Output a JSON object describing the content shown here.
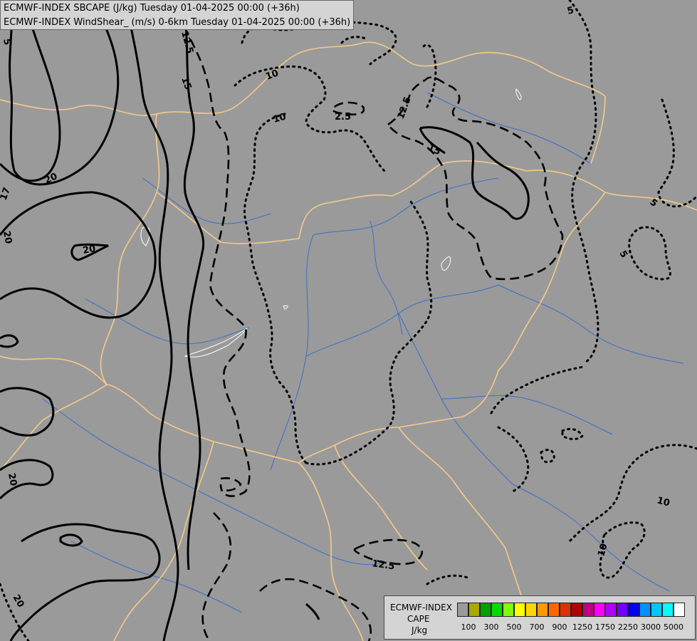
{
  "title": {
    "line1": "ECMWF-INDEX SBCAPE (J/kg) Tuesday 01-04-2025 00:00 (+36h)",
    "line2": "ECMWF-INDEX WindShear_ (m/s) 0-6km Tuesday 01-04-2025 00:00 (+36h)"
  },
  "legend": {
    "model": "ECMWF-INDEX",
    "variable": "CAPE",
    "unit": "J/kg",
    "colors": [
      "#9a9a9a",
      "#a8a800",
      "#00a000",
      "#00dc00",
      "#80ff00",
      "#ffff00",
      "#ffd700",
      "#ff9900",
      "#ff6600",
      "#e03000",
      "#b00000",
      "#c00080",
      "#ff00ff",
      "#b000ff",
      "#7000ff",
      "#0000ff",
      "#0090ff",
      "#00c8ff",
      "#00ffff",
      "#ffffff"
    ],
    "tick_labels": [
      "100",
      "300",
      "500",
      "700",
      "900",
      "1250",
      "1750",
      "2250",
      "3000",
      "5000"
    ]
  },
  "contour_labels": {
    "l15": "15",
    "l125": "12.5",
    "l10": "10",
    "l5": "5",
    "l20": "20",
    "l25": "2.5",
    "l17": "17"
  },
  "colors": {
    "background": "#9a9a9a",
    "borders": "#f5c98a",
    "rivers": "#3b6fc8",
    "contours": "#000000",
    "lakes": "#ffffff"
  }
}
